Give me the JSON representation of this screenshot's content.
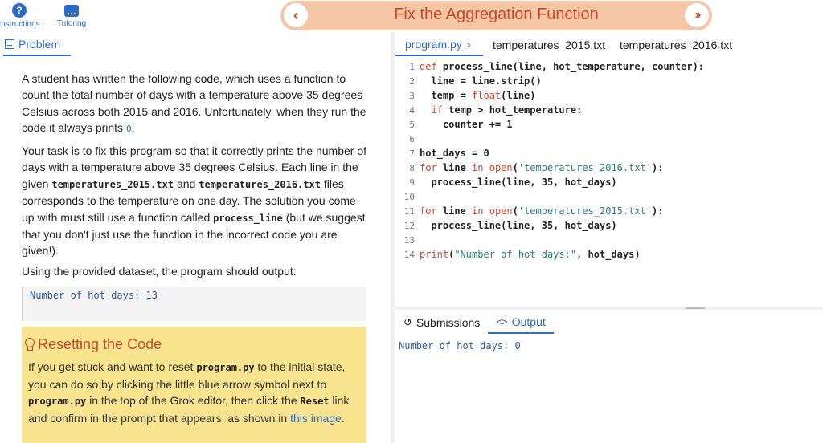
{
  "top": {
    "instructions_label": "Instructions",
    "tutoring_label": "Tutoring",
    "title": "Fix the Aggregation Function",
    "prev_icon": "chevron-left-icon",
    "next_icon": "double-chevron-right-icon"
  },
  "left": {
    "tab_label": "Problem",
    "p1": {
      "text": "A student has written the following code, which uses a function to count the total number of days with a temperature above 35 degrees Celsius across both 2015 and 2016. Unfortunately, when they run the code it always prints ",
      "code": "0",
      "end": "."
    },
    "p2": {
      "a": "Your task is to fix this program so that it correctly prints the number of days with a temperature above 35 degrees Celsius. Each line in the given ",
      "file1": "temperatures_2015.txt",
      "b": " and ",
      "file2": "temperatures_2016.txt",
      "c": " files corresponds to the temperature on one day. The solution you come up with must still use a function called ",
      "func": "process_line",
      "d": " (but we suggest that you don't just use the function in the incorrect code you are given!)."
    },
    "p3": "Using the provided dataset, the program should output:",
    "expected_output": "Number of hot days: 13",
    "tip": {
      "title": "Resetting the Code",
      "a": "If you get stuck and want to reset ",
      "file": "program.py",
      "b": " to the initial state, you can do so by clicking the little blue arrow symbol next to ",
      "file2": "program.py",
      "c": " in the top of the Grok editor, then click the ",
      "reset": "Reset",
      "d": " link and confirm in the prompt that appears, as shown in ",
      "link": "this image",
      "e": "."
    }
  },
  "editor": {
    "tabs": [
      {
        "label": "program.py",
        "chevron": "›"
      },
      {
        "label": "temperatures_2015.txt"
      },
      {
        "label": "temperatures_2016.txt"
      }
    ],
    "lines": [
      {
        "n": "1"
      },
      {
        "n": "2"
      },
      {
        "n": "3"
      },
      {
        "n": "4"
      },
      {
        "n": "5"
      },
      {
        "n": "6"
      },
      {
        "n": "7"
      },
      {
        "n": "8"
      },
      {
        "n": "9"
      },
      {
        "n": "10"
      },
      {
        "n": "11"
      },
      {
        "n": "12"
      },
      {
        "n": "13"
      },
      {
        "n": "14"
      }
    ],
    "code": {
      "l1": {
        "kw": "def",
        "rest": " process_line(line, hot_temperature, counter):"
      },
      "l2": {
        "a": "  line = line.strip()"
      },
      "l3": {
        "a": "  temp = ",
        "fn": "float",
        "b": "(line)"
      },
      "l4": {
        "kw": "  if",
        "b": " temp > hot_temperature:"
      },
      "l5": {
        "a": "    counter += 1"
      },
      "l7": {
        "a": "hot_days = 0"
      },
      "l8": {
        "kw": "for",
        "b": " line ",
        "kw2": "in",
        "fn": " open",
        "c": "(",
        "str": "'temperatures_2016.txt'",
        "d": "):"
      },
      "l9": {
        "a": "  process_line(line, 35, hot_days)"
      },
      "l11": {
        "kw": "for",
        "b": " line ",
        "kw2": "in",
        "fn": " open",
        "c": "(",
        "str": "'temperatures_2015.txt'",
        "d": "):"
      },
      "l12": {
        "a": "  process_line(line, 35, hot_days)"
      },
      "l14": {
        "fn": "print",
        "a": "(",
        "str": "\"Number of hot days:\"",
        "b": ", hot_days)"
      }
    }
  },
  "output": {
    "tabs": [
      {
        "label": "Submissions",
        "icon": "history-icon"
      },
      {
        "label": "Output",
        "icon": "code-icon"
      }
    ],
    "text": "Number of hot days: 0"
  }
}
